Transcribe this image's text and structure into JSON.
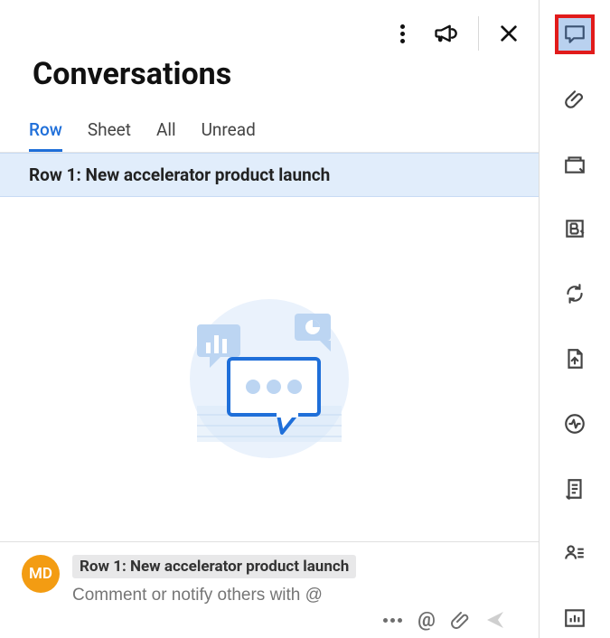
{
  "header": {
    "title": "Conversations"
  },
  "tabs": [
    {
      "label": "Row",
      "active": true
    },
    {
      "label": "Sheet",
      "active": false
    },
    {
      "label": "All",
      "active": false
    },
    {
      "label": "Unread",
      "active": false
    }
  ],
  "row_banner": "Row 1: New accelerator product launch",
  "composer": {
    "avatar_initials": "MD",
    "context_chip": "Row 1: New accelerator product launch",
    "placeholder": "Comment or notify others with @"
  },
  "sidebar_icons": [
    "comments-icon",
    "attachments-icon",
    "proofs-icon",
    "brand-icon",
    "refresh-icon",
    "upload-icon",
    "activity-icon",
    "document-icon",
    "people-icon",
    "chart-icon"
  ]
}
